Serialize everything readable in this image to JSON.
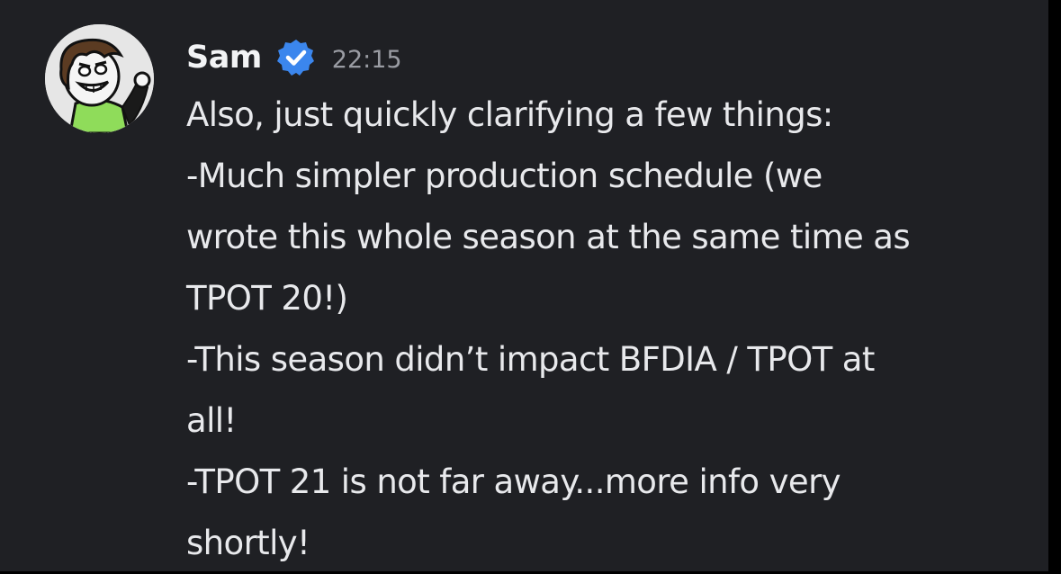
{
  "message": {
    "author": "Sam",
    "timestamp": "22:15",
    "badge_icon": "verified-checkmark-icon",
    "avatar_icon": "cartoon-avatar",
    "colors": {
      "background": "#1f2024",
      "username": "#f2f3f5",
      "timestamp": "#9a9ca3",
      "text": "#e8e9ec",
      "badge": "#3b86ed"
    },
    "lines": [
      "Also, just quickly clarifying a few things:",
      "-Much simpler production schedule (we",
      "wrote this whole season at the same time as",
      "TPOT 20!)",
      "-This season didn’t impact BFDIA / TPOT at",
      "all!",
      "-TPOT 21 is not far away...more info very",
      "shortly!"
    ]
  }
}
